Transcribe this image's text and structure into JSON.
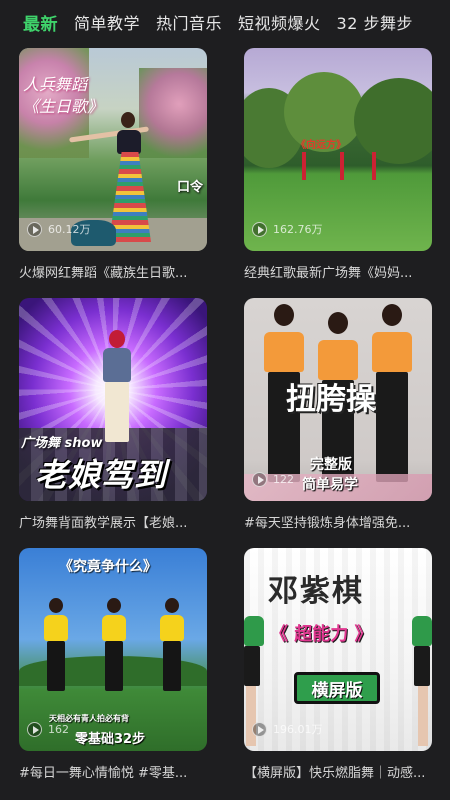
{
  "tabs": [
    {
      "label": "最新",
      "active": true
    },
    {
      "label": "简单教学",
      "active": false
    },
    {
      "label": "热门音乐",
      "active": false
    },
    {
      "label": "短视频爆火",
      "active": false
    },
    {
      "label": "32 步舞步",
      "active": false
    }
  ],
  "videos": [
    {
      "caption": "火爆网红舞蹈《藏族生日歌...",
      "views": "60.12万",
      "overlay_text": [
        "人兵舞蹈",
        "《生日歌》"
      ],
      "corner_text": "口令"
    },
    {
      "caption": "经典红歌最新广场舞《妈妈...",
      "views": "162.76万",
      "banner_text": "《向远方》"
    },
    {
      "caption": "广场舞背面教学展示【老娘...",
      "views": "",
      "overlay_small": "广场舞 show",
      "overlay_big": "老娘驾到"
    },
    {
      "caption": "#每天坚持锻炼身体增强免...",
      "views": "122",
      "overlay_big": "扭胯操",
      "overlay_sub1": "完整版",
      "overlay_sub2": "简单易学"
    },
    {
      "caption": "#每日一舞心情愉悦 #零基...",
      "views": "162",
      "overlay_top": "《究竟争什么》",
      "overlay_slogan": "天相必有青人拍必有背",
      "overlay_bottom": "零基础32步"
    },
    {
      "caption": "【横屏版】快乐燃脂舞｜动感...",
      "views": "196.01万",
      "overlay_name": "邓紫棋",
      "overlay_song": "《 超能力 》",
      "overlay_badge": "横屏版"
    }
  ],
  "colors": {
    "accent": "#3fd36b",
    "background": "#1e1e20"
  }
}
